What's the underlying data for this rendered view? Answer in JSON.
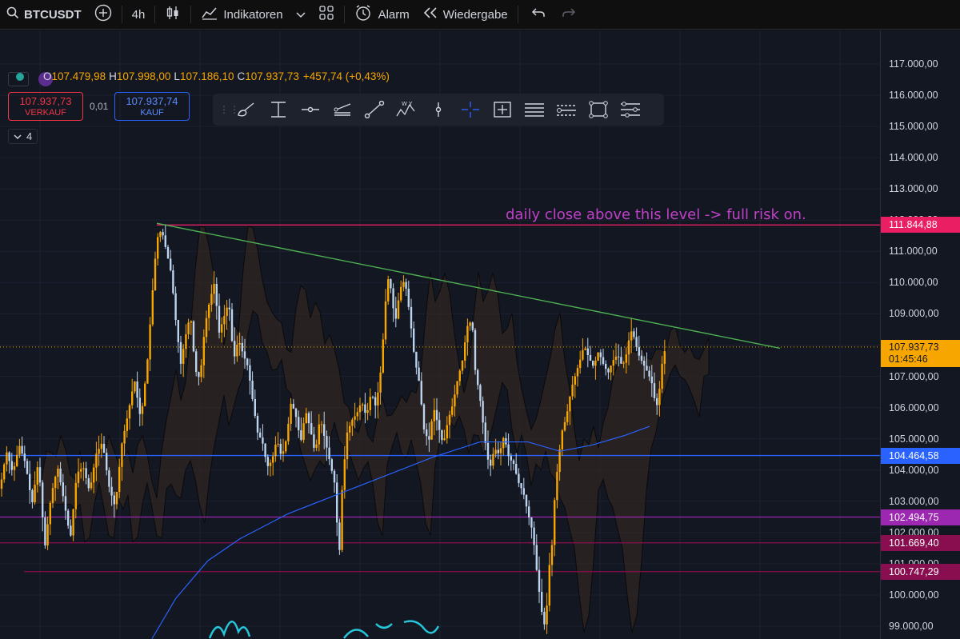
{
  "toolbar": {
    "symbol": "BTCUSDT",
    "interval": "4h",
    "indicators_label": "Indikatoren",
    "alarm_label": "Alarm",
    "replay_label": "Wiedergabe"
  },
  "legend": {
    "o_label": "O",
    "o_value": "107.479,98",
    "h_label": "H",
    "h_value": "107.998,00",
    "l_label": "L",
    "l_value": "107.186,10",
    "c_label": "C",
    "c_value": "107.937,73",
    "change": "+457,74 (+0,43%)"
  },
  "trade": {
    "sell_price": "107.937,73",
    "sell_label": "VERKAUF",
    "spread": "0,01",
    "buy_price": "107.937,74",
    "buy_label": "KAUF"
  },
  "layers_count": "4",
  "colors": {
    "background": "#131722",
    "candle_up": "#f7a600",
    "candle_down": "#bcd4ee",
    "trendline": "#4caf50",
    "resistance": "#e91e63",
    "support_blue": "#2962ff",
    "support_purple": "#9c27b0",
    "support_maroon": "#880e4f",
    "ma_line": "#2962ff",
    "annotation": "#c040c8"
  },
  "chart_data": {
    "type": "candlestick",
    "symbol": "BTCUSDT",
    "interval": "4h",
    "ylim": [
      98500,
      117500
    ],
    "y_ticks": [
      "117.000,00",
      "116.000,00",
      "115.000,00",
      "114.000,00",
      "113.000,00",
      "112.000,00",
      "111.000,00",
      "110.000,00",
      "109.000,00",
      "108.000,00",
      "107.000,00",
      "106.000,00",
      "105.000,00",
      "104.000,00",
      "103.000,00",
      "102.000,00",
      "101.000,00",
      "100.000,00",
      "99.000,00"
    ],
    "y_tick_values": [
      117000,
      116000,
      115000,
      114000,
      113000,
      112000,
      111000,
      110000,
      109000,
      108000,
      107000,
      106000,
      105000,
      104000,
      103000,
      102000,
      101000,
      100000,
      99000
    ],
    "price_path": [
      [
        0,
        103400
      ],
      [
        8,
        104600
      ],
      [
        16,
        103900
      ],
      [
        24,
        104800
      ],
      [
        32,
        104200
      ],
      [
        40,
        102900
      ],
      [
        48,
        104300
      ],
      [
        56,
        101500
      ],
      [
        64,
        103200
      ],
      [
        72,
        104100
      ],
      [
        80,
        103000
      ],
      [
        88,
        101800
      ],
      [
        96,
        103900
      ],
      [
        104,
        104100
      ],
      [
        112,
        103300
      ],
      [
        120,
        104500
      ],
      [
        128,
        104900
      ],
      [
        136,
        103500
      ],
      [
        144,
        102800
      ],
      [
        152,
        104800
      ],
      [
        160,
        105800
      ],
      [
        168,
        106900
      ],
      [
        176,
        105600
      ],
      [
        184,
        107400
      ],
      [
        190,
        109500
      ],
      [
        196,
        111400
      ],
      [
        202,
        111700
      ],
      [
        208,
        111000
      ],
      [
        214,
        110300
      ],
      [
        220,
        108700
      ],
      [
        226,
        107400
      ],
      [
        232,
        108300
      ],
      [
        238,
        109000
      ],
      [
        244,
        107200
      ],
      [
        250,
        106900
      ],
      [
        256,
        108600
      ],
      [
        262,
        109400
      ],
      [
        268,
        110000
      ],
      [
        274,
        108400
      ],
      [
        280,
        108900
      ],
      [
        286,
        109400
      ],
      [
        292,
        107500
      ],
      [
        298,
        108200
      ],
      [
        304,
        107700
      ],
      [
        310,
        107300
      ],
      [
        316,
        106200
      ],
      [
        322,
        105200
      ],
      [
        328,
        104900
      ],
      [
        334,
        104100
      ],
      [
        340,
        104300
      ],
      [
        346,
        105000
      ],
      [
        352,
        104400
      ],
      [
        358,
        105000
      ],
      [
        364,
        106200
      ],
      [
        370,
        105700
      ],
      [
        376,
        104900
      ],
      [
        382,
        105900
      ],
      [
        388,
        105300
      ],
      [
        394,
        104500
      ],
      [
        400,
        105700
      ],
      [
        406,
        105000
      ],
      [
        412,
        104300
      ],
      [
        418,
        103600
      ],
      [
        424,
        101200
      ],
      [
        428,
        103600
      ],
      [
        434,
        105200
      ],
      [
        440,
        105600
      ],
      [
        446,
        105800
      ],
      [
        452,
        106200
      ],
      [
        458,
        105700
      ],
      [
        464,
        106500
      ],
      [
        470,
        106000
      ],
      [
        476,
        107200
      ],
      [
        480,
        108600
      ],
      [
        484,
        110200
      ],
      [
        488,
        109900
      ],
      [
        494,
        108700
      ],
      [
        500,
        109800
      ],
      [
        506,
        110100
      ],
      [
        512,
        109000
      ],
      [
        518,
        107600
      ],
      [
        524,
        106800
      ],
      [
        530,
        105300
      ],
      [
        536,
        104900
      ],
      [
        542,
        106000
      ],
      [
        548,
        105400
      ],
      [
        554,
        104800
      ],
      [
        560,
        105600
      ],
      [
        566,
        106100
      ],
      [
        572,
        106900
      ],
      [
        578,
        107500
      ],
      [
        584,
        108600
      ],
      [
        590,
        108800
      ],
      [
        594,
        107200
      ],
      [
        600,
        106300
      ],
      [
        606,
        105000
      ],
      [
        612,
        104000
      ],
      [
        618,
        104700
      ],
      [
        624,
        104500
      ],
      [
        630,
        105100
      ],
      [
        636,
        104400
      ],
      [
        642,
        104200
      ],
      [
        648,
        103600
      ],
      [
        654,
        103300
      ],
      [
        660,
        102600
      ],
      [
        666,
        102000
      ],
      [
        672,
        100500
      ],
      [
        678,
        99300
      ],
      [
        682,
        98900
      ],
      [
        686,
        100800
      ],
      [
        690,
        101600
      ],
      [
        694,
        103400
      ],
      [
        698,
        104300
      ],
      [
        702,
        105200
      ],
      [
        708,
        105700
      ],
      [
        714,
        106600
      ],
      [
        720,
        107100
      ],
      [
        726,
        107600
      ],
      [
        730,
        108000
      ],
      [
        736,
        107600
      ],
      [
        742,
        107300
      ],
      [
        748,
        107800
      ],
      [
        754,
        107400
      ],
      [
        760,
        107100
      ],
      [
        766,
        107500
      ],
      [
        772,
        107700
      ],
      [
        778,
        107300
      ],
      [
        784,
        107800
      ],
      [
        788,
        108500
      ],
      [
        792,
        108300
      ],
      [
        798,
        107700
      ],
      [
        804,
        107400
      ],
      [
        810,
        107100
      ],
      [
        816,
        106700
      ],
      [
        820,
        105900
      ],
      [
        824,
        106500
      ],
      [
        828,
        107500
      ],
      [
        832,
        107937
      ]
    ],
    "ma_path": [
      [
        190,
        98600
      ],
      [
        220,
        99900
      ],
      [
        260,
        101100
      ],
      [
        300,
        101800
      ],
      [
        360,
        102600
      ],
      [
        420,
        103200
      ],
      [
        480,
        103800
      ],
      [
        540,
        104400
      ],
      [
        600,
        104900
      ],
      [
        660,
        104900
      ],
      [
        700,
        104600
      ],
      [
        740,
        104800
      ],
      [
        780,
        105100
      ],
      [
        812,
        105400
      ]
    ],
    "trendline": {
      "from": [
        196,
        111900
      ],
      "to": [
        975,
        107900
      ]
    },
    "horizontal_lines": [
      {
        "price": 111844.88,
        "label": "111.844,88",
        "color": "#e91e63",
        "x_start": 196
      },
      {
        "price": 104464.58,
        "label": "104.464,58",
        "color": "#2962ff",
        "x_start": 0
      },
      {
        "price": 102494.75,
        "label": "102.494,75",
        "color": "#9c27b0",
        "x_start": 0
      },
      {
        "price": 101669.4,
        "label": "101.669,40",
        "color": "#880e4f",
        "x_start": 0
      },
      {
        "price": 100747.29,
        "label": "100.747,29",
        "color": "#880e4f",
        "x_start": 30
      }
    ],
    "current_price": {
      "price": 107937.73,
      "label": "107.937,73",
      "countdown": "01:45:46",
      "color": "#f7a600"
    },
    "annotation_text": "daily close above this level -> full risk on."
  }
}
